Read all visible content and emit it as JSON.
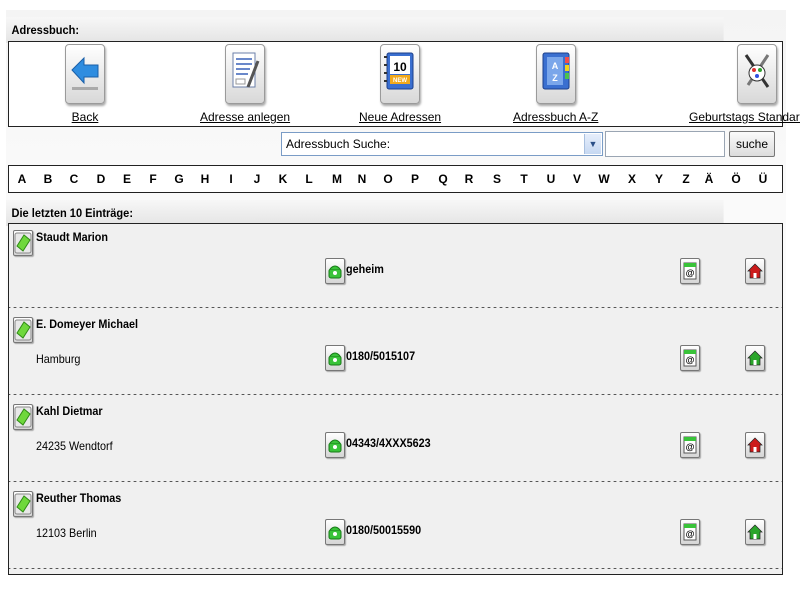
{
  "header": {
    "title": "Adressbuch:"
  },
  "toolbar": {
    "back": "Back",
    "create": "Adresse anlegen",
    "new_addresses": "Neue Adressen",
    "az": "Adressbuch A-Z",
    "birthday": "Geburtstags Standardtext",
    "new_badge": "10",
    "new_badge_sub": "NEW"
  },
  "search": {
    "select_value": "Adressbuch Suche:",
    "input_value": "",
    "button": "suche"
  },
  "alphabet": [
    "A",
    "B",
    "C",
    "D",
    "E",
    "F",
    "G",
    "H",
    "I",
    "J",
    "K",
    "L",
    "M",
    "N",
    "O",
    "P",
    "Q",
    "R",
    "S",
    "T",
    "U",
    "V",
    "W",
    "X",
    "Y",
    "Z",
    "Ä",
    "Ö",
    "Ü"
  ],
  "last_entries": {
    "title": "Die letzten 10 Einträge:",
    "items": [
      {
        "name": "Staudt Marion",
        "city": "",
        "phone": "geheim",
        "home_color": "#cc1a1a"
      },
      {
        "name": "E. Domeyer Michael",
        "city": "Hamburg",
        "phone": "0180/5015107",
        "home_color": "#2aa52a"
      },
      {
        "name": "Kahl Dietmar",
        "city": "24235 Wendtorf",
        "phone": "04343/4XXX5623",
        "home_color": "#cc1a1a"
      },
      {
        "name": "Reuther Thomas",
        "city": "12103 Berlin",
        "phone": "0180/50015590",
        "home_color": "#2aa52a"
      }
    ]
  },
  "colors": {
    "accent_green": "#5ccd2a",
    "border": "#222222",
    "select_border": "#7a9cc6"
  }
}
